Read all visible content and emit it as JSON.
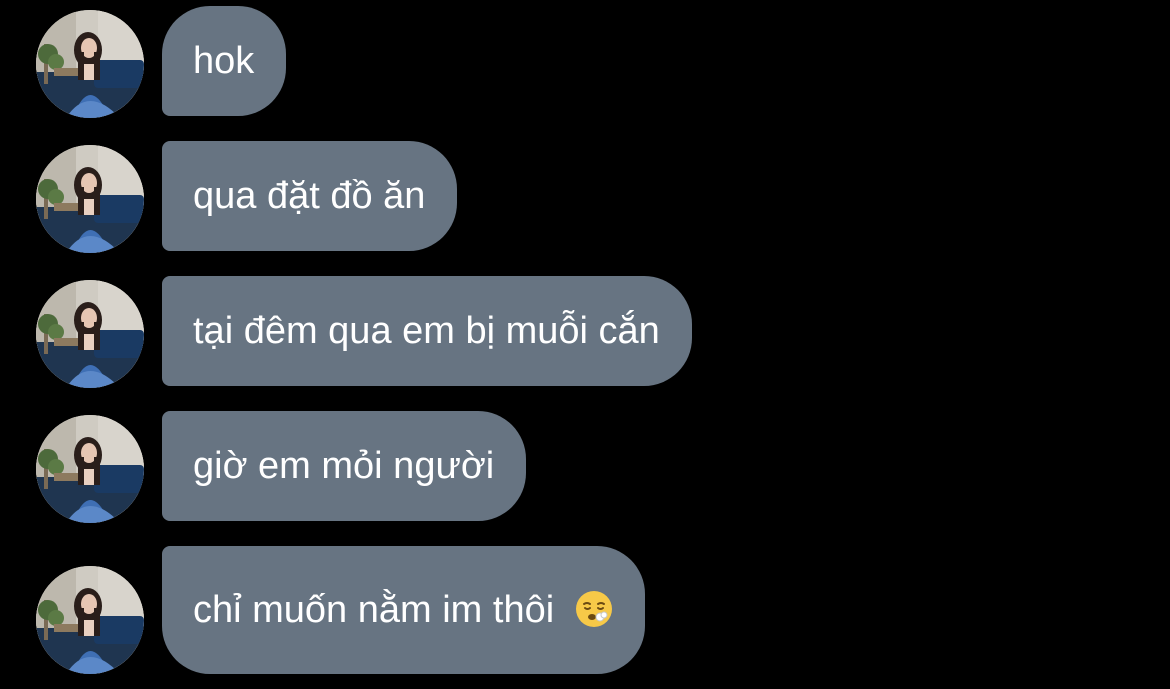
{
  "conversation": {
    "messages": [
      {
        "text": "hok"
      },
      {
        "text": "qua đặt đồ ăn"
      },
      {
        "text": "tại đêm qua em bị muỗi cắn"
      },
      {
        "text": "giờ em mỏi người"
      },
      {
        "text": "chỉ muốn nằm im thôi",
        "emoji": "tired-face-emoji"
      }
    ]
  },
  "colors": {
    "background": "#000000",
    "bubble": "#677482",
    "text": "#ffffff"
  }
}
